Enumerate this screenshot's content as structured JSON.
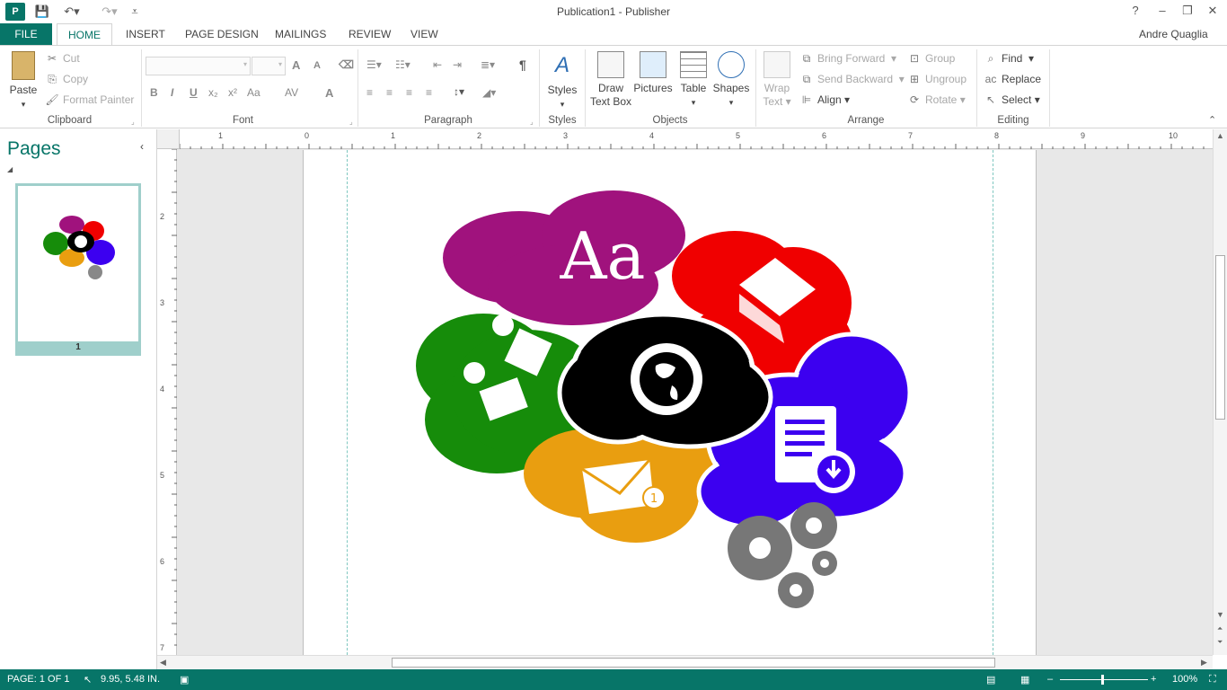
{
  "window": {
    "title": "Publication1 - Publisher",
    "user": "Andre Quaglia",
    "help": "?"
  },
  "tabs": [
    "FILE",
    "HOME",
    "INSERT",
    "PAGE DESIGN",
    "MAILINGS",
    "REVIEW",
    "VIEW"
  ],
  "clipboard": {
    "paste": "Paste",
    "cut": "Cut",
    "copy": "Copy",
    "format_painter": "Format Painter",
    "label": "Clipboard"
  },
  "font": {
    "label": "Font",
    "bold": "B",
    "italic": "I",
    "underline": "U",
    "subscript": "x₂",
    "superscript": "x²",
    "change_case": "Aa",
    "spacing": "AV",
    "color": "A",
    "grow": "A",
    "shrink": "A"
  },
  "paragraph": {
    "label": "Paragraph",
    "pilcrow": "¶"
  },
  "styles": {
    "button": "Styles",
    "label": "Styles"
  },
  "objects": {
    "draw_text_box_1": "Draw",
    "draw_text_box_2": "Text Box",
    "pictures": "Pictures",
    "table": "Table",
    "shapes": "Shapes",
    "label": "Objects"
  },
  "arrange": {
    "wrap_1": "Wrap",
    "wrap_2": "Text",
    "bring_forward": "Bring Forward",
    "send_backward": "Send Backward",
    "align": "Align",
    "group": "Group",
    "ungroup": "Ungroup",
    "rotate": "Rotate",
    "label": "Arrange"
  },
  "editing": {
    "find": "Find",
    "replace": "Replace",
    "select": "Select",
    "label": "Editing"
  },
  "pages_pane": {
    "title": "Pages",
    "page_number": "1"
  },
  "ruler": {
    "h": [
      "1",
      "0",
      "1",
      "2",
      "3",
      "4",
      "5",
      "6",
      "7",
      "8",
      "9",
      "10"
    ],
    "v": [
      "2",
      "3",
      "4",
      "5",
      "6",
      "7"
    ]
  },
  "artwork": {
    "text": "Aa",
    "badge": "1"
  },
  "status": {
    "page": "PAGE: 1 OF 1",
    "position": "9.95, 5.48 IN.",
    "zoom": "100%"
  },
  "colors": {
    "accent": "#077568",
    "purple": "#a0127d",
    "red": "#f00000",
    "green": "#168c0a",
    "black": "#000000",
    "orange": "#e99e10",
    "blue": "#3c00f0",
    "gear": "#777777"
  }
}
